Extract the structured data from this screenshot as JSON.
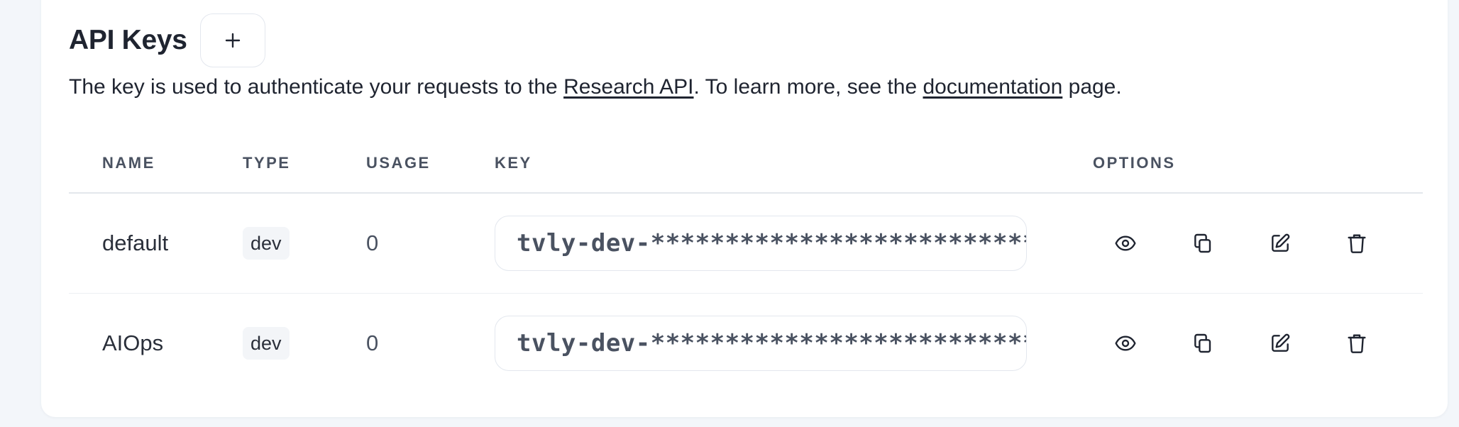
{
  "header": {
    "title": "API Keys",
    "add_button_icon": "plus-icon"
  },
  "description": {
    "prefix": "The key is used to authenticate your requests to the ",
    "link_research_api": "Research API",
    "middle": ". To learn more, see the ",
    "link_documentation": "documentation",
    "suffix": " page."
  },
  "table": {
    "columns": {
      "name": "NAME",
      "type": "TYPE",
      "usage": "USAGE",
      "key": "KEY",
      "options": "OPTIONS"
    },
    "rows": [
      {
        "name": "default",
        "type": "dev",
        "usage": "0",
        "key": "tvly-dev-********************************"
      },
      {
        "name": "AIOps",
        "type": "dev",
        "usage": "0",
        "key": "tvly-dev-********************************"
      }
    ],
    "option_icons": [
      "eye-icon",
      "copy-icon",
      "edit-icon",
      "trash-icon"
    ]
  },
  "colors": {
    "background": "#f3f6fa",
    "card": "#ffffff",
    "text": "#1f2430",
    "muted": "#4a5261",
    "border": "#e3e7ee"
  }
}
